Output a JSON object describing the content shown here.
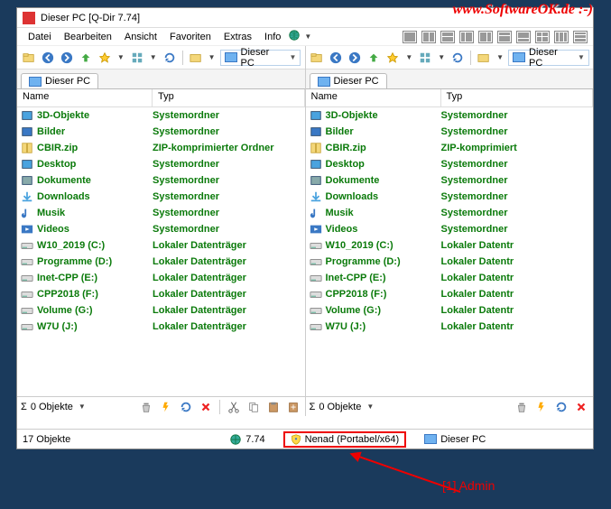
{
  "watermark": "www.SoftwareOK.de :-)",
  "title": "Dieser PC  [Q-Dir 7.74]",
  "menu": {
    "datei": "Datei",
    "bearbeiten": "Bearbeiten",
    "ansicht": "Ansicht",
    "favoriten": "Favoriten",
    "extras": "Extras",
    "info": "Info"
  },
  "crumb_label": "Dieser PC",
  "tab_label": "Dieser PC",
  "columns": {
    "name": "Name",
    "typ": "Typ"
  },
  "status_zero": "0 Objekte",
  "footer": {
    "count": "17 Objekte",
    "version": "7.74",
    "admin": "Nenad (Portabel/x64)",
    "location": "Dieser PC"
  },
  "annotation": "[1] Admin",
  "panes": {
    "left": [
      {
        "icon": "3d",
        "name": "3D-Objekte",
        "type": "Systemordner"
      },
      {
        "icon": "img",
        "name": "Bilder",
        "type": "Systemordner"
      },
      {
        "icon": "zip",
        "name": "CBIR.zip",
        "type": "ZIP-komprimierter Ordner"
      },
      {
        "icon": "desk",
        "name": "Desktop",
        "type": "Systemordner"
      },
      {
        "icon": "doc",
        "name": "Dokumente",
        "type": "Systemordner"
      },
      {
        "icon": "dl",
        "name": "Downloads",
        "type": "Systemordner"
      },
      {
        "icon": "music",
        "name": "Musik",
        "type": "Systemordner"
      },
      {
        "icon": "vid",
        "name": "Videos",
        "type": "Systemordner"
      },
      {
        "icon": "disk",
        "name": "W10_2019 (C:)",
        "type": "Lokaler Datenträger"
      },
      {
        "icon": "disk",
        "name": "Programme (D:)",
        "type": "Lokaler Datenträger"
      },
      {
        "icon": "disk",
        "name": "Inet-CPP (E:)",
        "type": "Lokaler Datenträger"
      },
      {
        "icon": "disk",
        "name": "CPP2018 (F:)",
        "type": "Lokaler Datenträger"
      },
      {
        "icon": "disk",
        "name": "Volume (G:)",
        "type": "Lokaler Datenträger"
      },
      {
        "icon": "disk",
        "name": "W7U (J:)",
        "type": "Lokaler Datenträger"
      }
    ],
    "right": [
      {
        "icon": "3d",
        "name": "3D-Objekte",
        "type": "Systemordner"
      },
      {
        "icon": "img",
        "name": "Bilder",
        "type": "Systemordner"
      },
      {
        "icon": "zip",
        "name": "CBIR.zip",
        "type": "ZIP-komprimiert"
      },
      {
        "icon": "desk",
        "name": "Desktop",
        "type": "Systemordner"
      },
      {
        "icon": "doc",
        "name": "Dokumente",
        "type": "Systemordner"
      },
      {
        "icon": "dl",
        "name": "Downloads",
        "type": "Systemordner"
      },
      {
        "icon": "music",
        "name": "Musik",
        "type": "Systemordner"
      },
      {
        "icon": "vid",
        "name": "Videos",
        "type": "Systemordner"
      },
      {
        "icon": "disk",
        "name": "W10_2019 (C:)",
        "type": "Lokaler Datentr"
      },
      {
        "icon": "disk",
        "name": "Programme (D:)",
        "type": "Lokaler Datentr"
      },
      {
        "icon": "disk",
        "name": "Inet-CPP (E:)",
        "type": "Lokaler Datentr"
      },
      {
        "icon": "disk",
        "name": "CPP2018 (F:)",
        "type": "Lokaler Datentr"
      },
      {
        "icon": "disk",
        "name": "Volume (G:)",
        "type": "Lokaler Datentr"
      },
      {
        "icon": "disk",
        "name": "W7U (J:)",
        "type": "Lokaler Datentr"
      }
    ]
  },
  "icons": {
    "3d": "#4aa3df",
    "img": "#3a78c4",
    "zip": "#e6c24a",
    "desk": "#4aa3df",
    "doc": "#8aa",
    "dl": "#4aa3df",
    "music": "#3a78c4",
    "vid": "#3a78c4",
    "disk": "#888"
  }
}
